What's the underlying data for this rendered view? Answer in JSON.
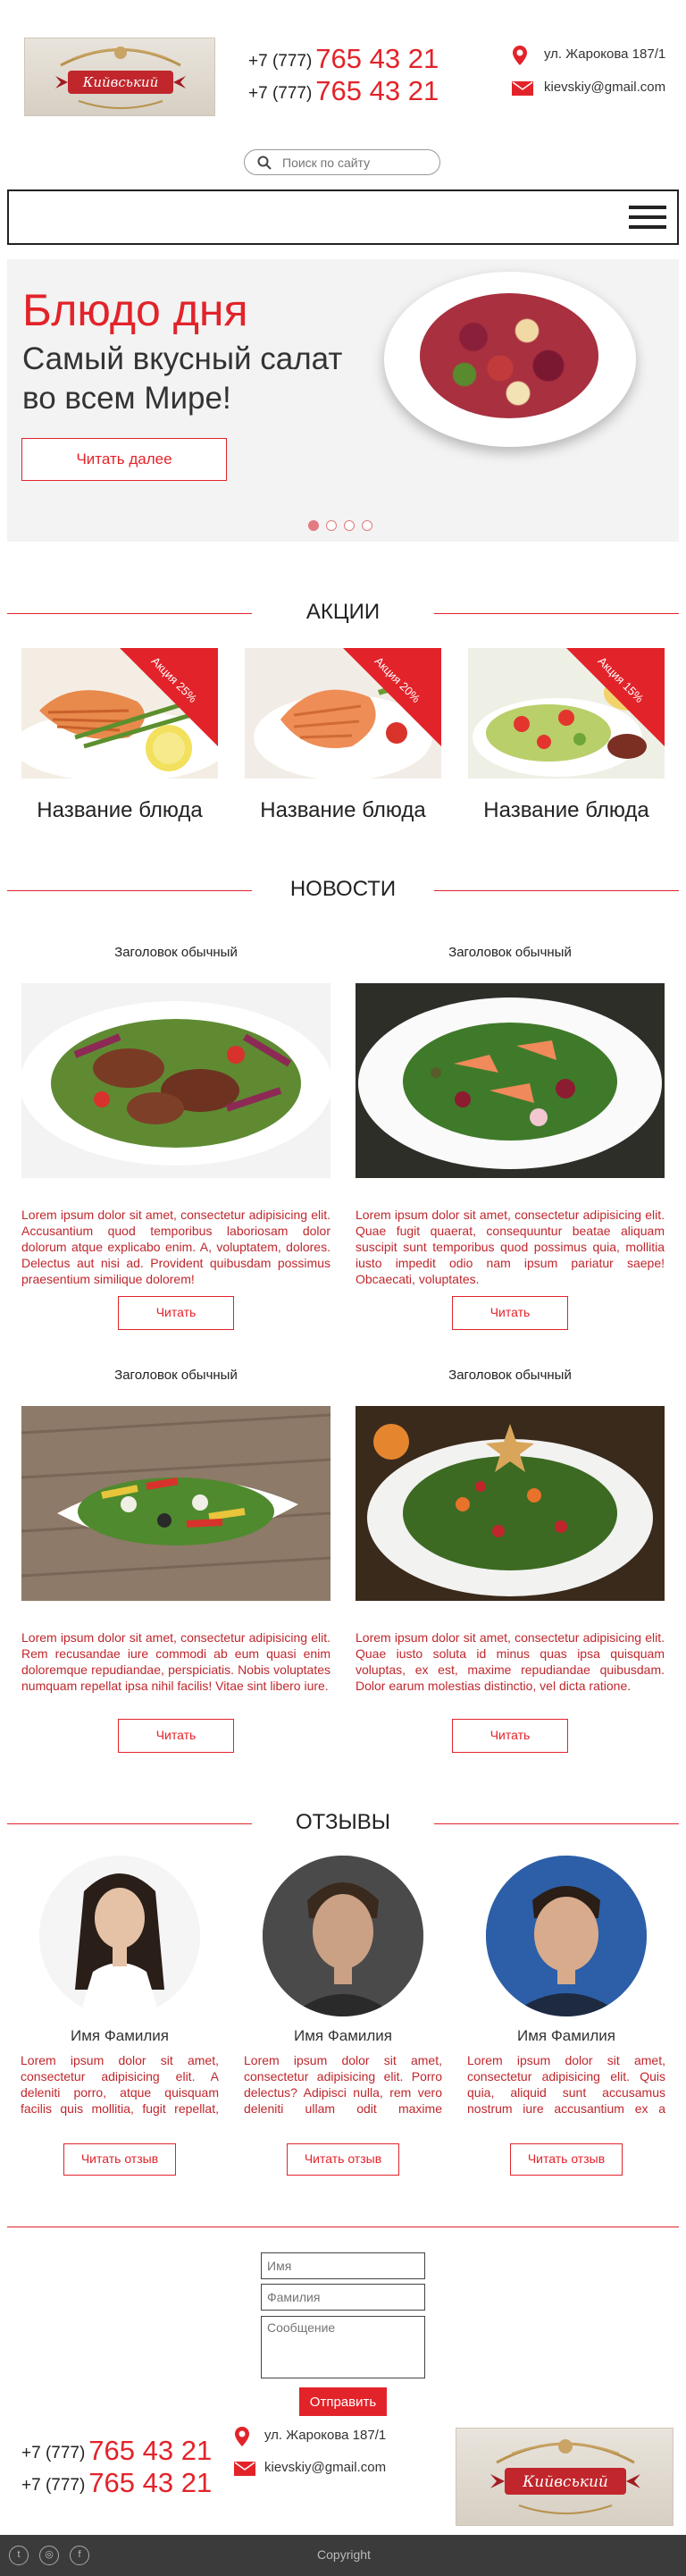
{
  "header": {
    "logo_text": "Кийвський",
    "phones": [
      {
        "prefix": "+7 (777)",
        "number": "765 43 21"
      },
      {
        "prefix": "+7 (777)",
        "number": "765 43 21"
      }
    ],
    "address": "ул. Жарокова 187/1",
    "email": "kievskiy@gmail.com",
    "search_placeholder": "Поиск по сайту"
  },
  "hero": {
    "title": "Блюдо дня",
    "subtitle": "Самый вкусный салат во всем Мире!",
    "button": "Читать далее",
    "slide_count": 4,
    "active_slide": 1
  },
  "promos": {
    "title": "АКЦИИ",
    "items": [
      {
        "badge": "Акция 25%",
        "name": "Название блюда"
      },
      {
        "badge": "Акция 20%",
        "name": "Название блюда"
      },
      {
        "badge": "Акция 15%",
        "name": "Название блюда"
      }
    ]
  },
  "news": {
    "title": "НОВОСТИ",
    "items": [
      {
        "heading": "Заголовок обычный",
        "text": "Lorem ipsum dolor sit amet, consectetur adipisicing elit. Accusantium quod temporibus laboriosam dolor dolorum atque explicabo enim. A, voluptatem, dolores. Delectus aut nisi ad. Provident quibusdam possimus praesentium similique dolorem!",
        "button": "Читать"
      },
      {
        "heading": "Заголовок обычный",
        "text": "Lorem ipsum dolor sit amet, consectetur adipisicing elit. Quae fugit quaerat, consequuntur beatae aliquam suscipit sunt temporibus quod possimus quia, mollitia iusto impedit odio nam ipsum pariatur saepe! Obcaecati, voluptates.",
        "button": "Читать"
      },
      {
        "heading": "Заголовок обычный",
        "text": "Lorem ipsum dolor sit amet, consectetur adipisicing elit. Rem recusandae iure commodi ab eum quasi enim doloremque repudiandae, perspiciatis. Nobis voluptates numquam repellat ipsa nihil facilis! Vitae sint libero iure.",
        "button": "Читать"
      },
      {
        "heading": "Заголовок обычный",
        "text": "Lorem ipsum dolor sit amet, consectetur adipisicing elit. Quae iusto soluta id minus quas ipsa quisquam voluptas, ex est, maxime repudiandae quibusdam. Dolor earum molestias distinctio, vel dicta ratione.",
        "button": "Читать"
      }
    ]
  },
  "reviews": {
    "title": "ОТЗЫВЫ",
    "items": [
      {
        "name": "Имя Фамилия",
        "text": "Lorem ipsum dolor sit amet, consectetur adipisicing elit. A deleniti porro, atque quisquam facilis quis mollitia, fugit repellat, eveniet ducimus soluta expedita",
        "button": "Читать отзыв"
      },
      {
        "name": "Имя Фамилия",
        "text": "Lorem ipsum dolor sit amet, consectetur adipisicing elit. Porro delectus? Adipisci nulla, rem vero deleniti ullam odit maxime cupiditate eveniet neque, omnis",
        "button": "Читать отзыв"
      },
      {
        "name": "Имя Фамилия",
        "text": "Lorem ipsum dolor sit amet, consectetur adipisicing elit. Quis quia, aliquid sunt accusamus nostrum iure accusantium ex a temporibus ipsum voluptatem",
        "button": "Читать отзыв"
      }
    ]
  },
  "form": {
    "name_placeholder": "Имя",
    "surname_placeholder": "Фамилия",
    "message_placeholder": "Сообщение",
    "submit": "Отправить"
  },
  "footer": {
    "copyright": "Copyright",
    "social": [
      "twitter-icon",
      "instagram-icon",
      "facebook-icon"
    ]
  },
  "colors": {
    "accent": "#e2232a",
    "footer_bg": "#3b3b3b"
  }
}
